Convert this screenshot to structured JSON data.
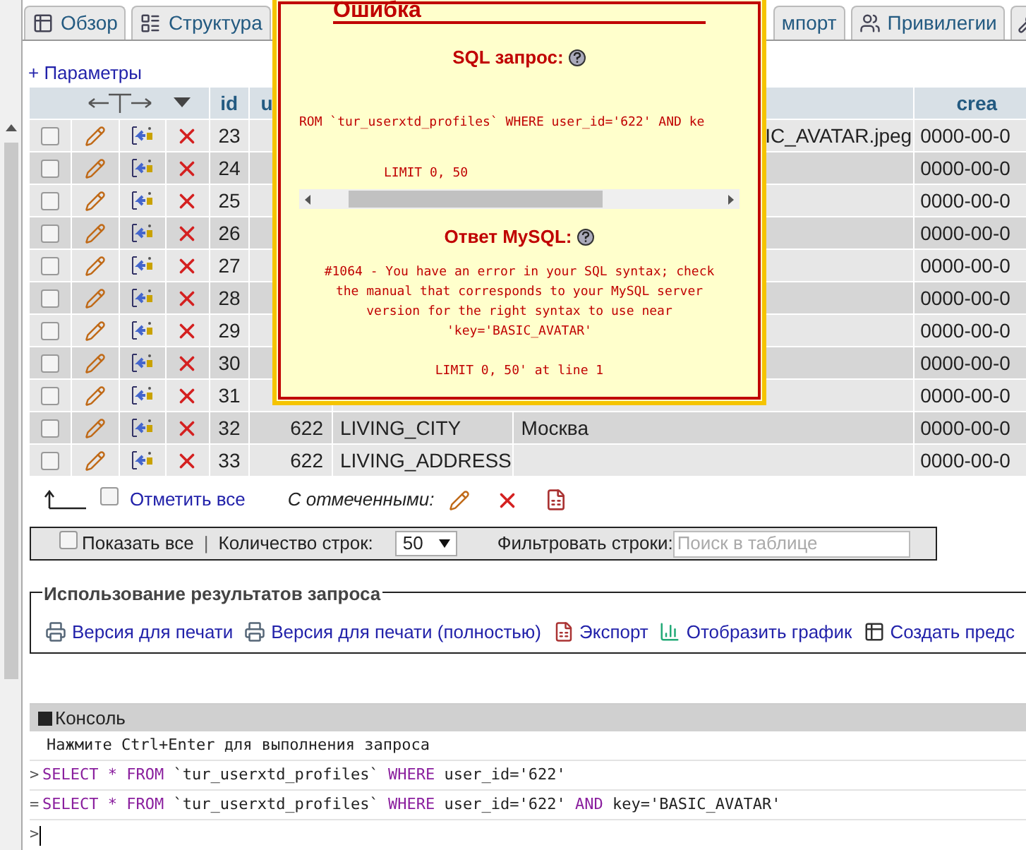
{
  "tabs": [
    {
      "label": "Обзор",
      "kind": "full"
    },
    {
      "label": "Структура",
      "kind": "full"
    },
    {
      "label": "мпорт",
      "kind": "clipped"
    },
    {
      "label": "Привилегии",
      "kind": "full"
    }
  ],
  "options_link": "+ Параметры",
  "table": {
    "columns": [
      {
        "label": "id"
      },
      {
        "label": "u"
      },
      {
        "label": "crea"
      }
    ],
    "rows": [
      {
        "id": "23",
        "checked": false,
        "value": "IC_AVATAR.jpeg",
        "created": "0000-00-0"
      },
      {
        "id": "24",
        "checked": false,
        "created": "0000-00-0"
      },
      {
        "id": "25",
        "checked": false,
        "created": "0000-00-0"
      },
      {
        "id": "26",
        "checked": false,
        "created": "0000-00-0"
      },
      {
        "id": "27",
        "checked": false,
        "created": "0000-00-0"
      },
      {
        "id": "28",
        "checked": false,
        "created": "0000-00-0"
      },
      {
        "id": "29",
        "checked": false,
        "created": "0000-00-0"
      },
      {
        "id": "30",
        "checked": false,
        "created": "0000-00-0"
      },
      {
        "id": "31",
        "checked": false,
        "created": "0000-00-0"
      },
      {
        "id": "32",
        "checked": false,
        "user_id": "622",
        "key": "LIVING_CITY",
        "value": "Москва",
        "created": "0000-00-0"
      },
      {
        "id": "33",
        "checked": false,
        "user_id": "622",
        "key": "LIVING_ADDRESS",
        "created": "0000-00-0"
      }
    ]
  },
  "bulk": {
    "check_all": "Отметить все",
    "checked": false,
    "with_selected": "С отмеченными:"
  },
  "filter_bar": {
    "show_all": "Показать все",
    "show_all_checked": false,
    "separator": "|",
    "rows_label": "Количество строк:",
    "rows_value": "50",
    "filter_label": "Фильтровать строки:",
    "filter_placeholder": "Поиск в таблице"
  },
  "query_results": {
    "legend": "Использование результатов запроса",
    "links": [
      {
        "label": "Версия для печати"
      },
      {
        "label": "Версия для печати (полностью)"
      },
      {
        "label": "Экспорт"
      },
      {
        "label": "Отобразить график"
      },
      {
        "label": "Создать предс"
      }
    ]
  },
  "error_dialog": {
    "title": "Ошибка",
    "sql_heading": "SQL запрос:",
    "sql_lines": [
      "ROM `tur_userxtd_profiles` WHERE user_id='622' AND ke",
      "LIMIT 0, 50"
    ],
    "response_heading": "Ответ MySQL:",
    "response": "#1064 - You have an error in your SQL syntax; check\nthe manual that corresponds to your MySQL server\nversion for the right syntax to use near\n'key='BASIC_AVATAR'\n\nLIMIT 0, 50' at line 1"
  },
  "console": {
    "title": "Консоль",
    "hint": "Нажмите Ctrl+Enter для выполнения запроса",
    "lines": [
      {
        "prefix": ">",
        "tokens": [
          {
            "kind": "keyword",
            "text": "SELECT * FROM"
          },
          {
            "kind": "plain",
            "text": " `tur_userxtd_profiles` "
          },
          {
            "kind": "keyword",
            "text": "WHERE"
          },
          {
            "kind": "plain",
            "text": " user_id='622'"
          }
        ]
      },
      {
        "prefix": "=",
        "tokens": [
          {
            "kind": "keyword",
            "text": "SELECT * FROM"
          },
          {
            "kind": "plain",
            "text": " `tur_userxtd_profiles` "
          },
          {
            "kind": "keyword",
            "text": "WHERE"
          },
          {
            "kind": "plain",
            "text": " user_id='622' "
          },
          {
            "kind": "keyword",
            "text": "AND"
          },
          {
            "kind": "plain",
            "text": " key='BASIC_AVATAR'"
          }
        ]
      }
    ],
    "prompt": ">"
  }
}
